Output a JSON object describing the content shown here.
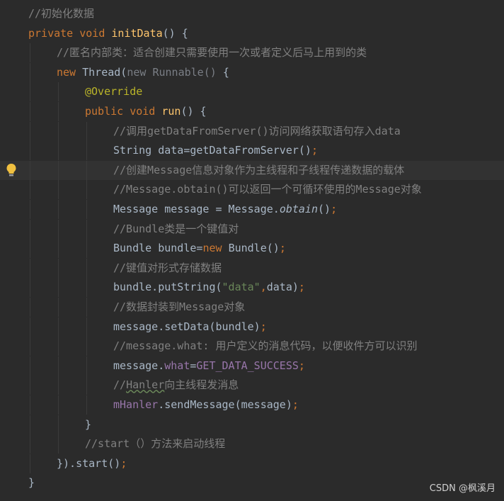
{
  "editor": {
    "lines": [
      {
        "indent": 0,
        "tokens": [
          {
            "t": "//初始化数据",
            "c": "comment"
          }
        ]
      },
      {
        "indent": 0,
        "tokens": [
          {
            "t": "private ",
            "c": "keyword"
          },
          {
            "t": "void ",
            "c": "keyword"
          },
          {
            "t": "initData",
            "c": "func"
          },
          {
            "t": "() {",
            "c": "plain"
          }
        ]
      },
      {
        "indent": 1,
        "tokens": [
          {
            "t": "//匿名内部类：适合创建只需要使用一次或者定义后马上用到的类",
            "c": "comment"
          }
        ]
      },
      {
        "indent": 1,
        "tokens": [
          {
            "t": "new ",
            "c": "keyword"
          },
          {
            "t": "Thread(",
            "c": "plain"
          },
          {
            "t": "new Runnable() ",
            "c": "dim"
          },
          {
            "t": "{",
            "c": "plain"
          }
        ]
      },
      {
        "indent": 2,
        "tokens": [
          {
            "t": "@Override",
            "c": "annot"
          }
        ]
      },
      {
        "indent": 2,
        "tokens": [
          {
            "t": "public ",
            "c": "keyword"
          },
          {
            "t": "void ",
            "c": "keyword"
          },
          {
            "t": "run",
            "c": "func"
          },
          {
            "t": "() {",
            "c": "plain"
          }
        ]
      },
      {
        "indent": 3,
        "tokens": [
          {
            "t": "//调用getDataFromServer()访问网络获取语句存入data",
            "c": "comment"
          }
        ]
      },
      {
        "indent": 3,
        "tokens": [
          {
            "t": "String data=getDataFromServer()",
            "c": "plain"
          },
          {
            "t": ";",
            "c": "semi"
          }
        ]
      },
      {
        "indent": 3,
        "highlight": true,
        "bulb": true,
        "tokens": [
          {
            "t": "//创建Message信息对象作为主线程和子线程传递数据的载体",
            "c": "comment"
          }
        ]
      },
      {
        "indent": 3,
        "tokens": [
          {
            "t": "//Message.obtain()可以返回一个可循环使用的Message对象",
            "c": "comment"
          }
        ]
      },
      {
        "indent": 3,
        "tokens": [
          {
            "t": "Message message = Message.",
            "c": "plain"
          },
          {
            "t": "obtain",
            "c": "static"
          },
          {
            "t": "()",
            "c": "plain"
          },
          {
            "t": ";",
            "c": "semi"
          }
        ]
      },
      {
        "indent": 3,
        "tokens": [
          {
            "t": "//Bundle类是一个键值对",
            "c": "comment"
          }
        ]
      },
      {
        "indent": 3,
        "tokens": [
          {
            "t": "Bundle bundle=",
            "c": "plain"
          },
          {
            "t": "new ",
            "c": "keyword"
          },
          {
            "t": "Bundle()",
            "c": "plain"
          },
          {
            "t": ";",
            "c": "semi"
          }
        ]
      },
      {
        "indent": 3,
        "tokens": [
          {
            "t": "//键值对形式存储数据",
            "c": "comment"
          }
        ]
      },
      {
        "indent": 3,
        "tokens": [
          {
            "t": "bundle.putString(",
            "c": "plain"
          },
          {
            "t": "\"data\"",
            "c": "string"
          },
          {
            "t": ",",
            "c": "semi"
          },
          {
            "t": "data)",
            "c": "plain"
          },
          {
            "t": ";",
            "c": "semi"
          }
        ]
      },
      {
        "indent": 3,
        "tokens": [
          {
            "t": "//数据封装到Message对象",
            "c": "comment"
          }
        ]
      },
      {
        "indent": 3,
        "tokens": [
          {
            "t": "message.setData(bundle)",
            "c": "plain"
          },
          {
            "t": ";",
            "c": "semi"
          }
        ]
      },
      {
        "indent": 3,
        "tokens": [
          {
            "t": "//message.what: 用户定义的消息代码，以便收件方可以识别",
            "c": "comment"
          }
        ]
      },
      {
        "indent": 3,
        "tokens": [
          {
            "t": "message.",
            "c": "plain"
          },
          {
            "t": "what",
            "c": "field"
          },
          {
            "t": "=",
            "c": "plain"
          },
          {
            "t": "GET_DATA_SUCCESS",
            "c": "field"
          },
          {
            "t": ";",
            "c": "semi"
          }
        ]
      },
      {
        "indent": 3,
        "tokens": [
          {
            "t": "//",
            "c": "comment"
          },
          {
            "t": "Hanler",
            "c": "ul"
          },
          {
            "t": "向主线程发消息",
            "c": "comment"
          }
        ]
      },
      {
        "indent": 3,
        "tokens": [
          {
            "t": "mHanler",
            "c": "field"
          },
          {
            "t": ".sendMessage(message)",
            "c": "plain"
          },
          {
            "t": ";",
            "c": "semi"
          }
        ]
      },
      {
        "indent": 2,
        "tokens": [
          {
            "t": "}",
            "c": "plain"
          }
        ]
      },
      {
        "indent": 2,
        "tokens": [
          {
            "t": "//start（）方法来启动线程",
            "c": "comment"
          }
        ]
      },
      {
        "indent": 1,
        "tokens": [
          {
            "t": "}).start()",
            "c": "plain"
          },
          {
            "t": ";",
            "c": "semi"
          }
        ]
      },
      {
        "indent": 0,
        "tokens": [
          {
            "t": "}",
            "c": "plain"
          }
        ]
      }
    ]
  },
  "gutter": {
    "bulb_icon": "lightbulb-icon",
    "bulb_color": "#f0c040"
  },
  "watermark": {
    "text": "CSDN @枫溪月"
  }
}
